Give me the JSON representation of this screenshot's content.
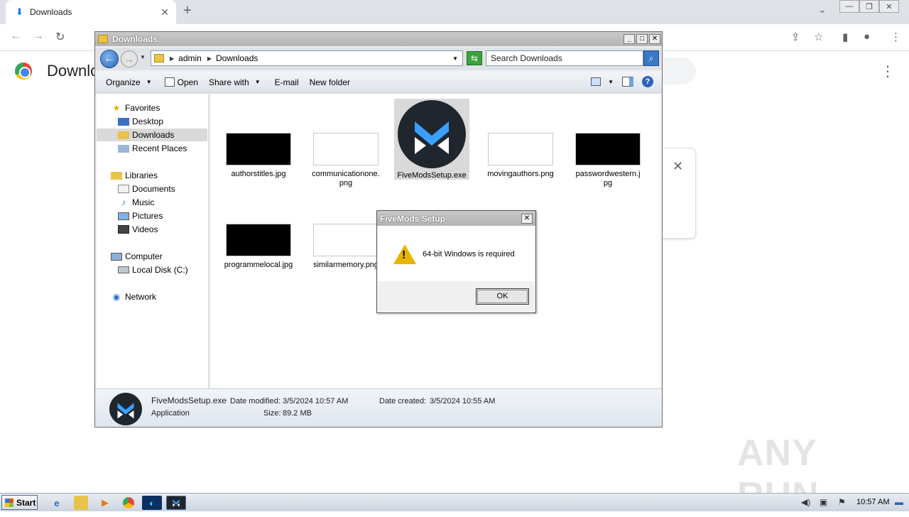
{
  "browser": {
    "tab_title": "Downloads",
    "page_title": "Downloads"
  },
  "explorer": {
    "title": "Downloads",
    "breadcrumb": [
      "admin",
      "Downloads"
    ],
    "search_placeholder": "Search Downloads",
    "commands": {
      "organize": "Organize",
      "open": "Open",
      "share_with": "Share with",
      "email": "E-mail",
      "new_folder": "New folder"
    },
    "nav": {
      "favorites": "Favorites",
      "desktop": "Desktop",
      "downloads": "Downloads",
      "recent_places": "Recent Places",
      "libraries": "Libraries",
      "documents": "Documents",
      "music": "Music",
      "pictures": "Pictures",
      "videos": "Videos",
      "computer": "Computer",
      "local_disk": "Local Disk (C:)",
      "network": "Network"
    },
    "files": [
      {
        "name": "authorstitles.jpg",
        "thumb": "dark"
      },
      {
        "name": "communicationone.png",
        "thumb": "light"
      },
      {
        "name": "FiveModsSetup.exe",
        "thumb": "logo",
        "selected": true
      },
      {
        "name": "movingauthors.png",
        "thumb": "light"
      },
      {
        "name": "passwordwestern.jpg",
        "thumb": "dark"
      },
      {
        "name": "programmelocal.jpg",
        "thumb": "dark"
      },
      {
        "name": "similarmemory.png",
        "thumb": "light"
      }
    ],
    "status": {
      "name": "FiveModsSetup.exe",
      "type": "Application",
      "date_modified_label": "Date modified:",
      "date_modified": "3/5/2024 10:57 AM",
      "size_label": "Size:",
      "size": "89.2 MB",
      "date_created_label": "Date created:",
      "date_created": "3/5/2024 10:55 AM"
    }
  },
  "dialog": {
    "title": "FiveMods Setup",
    "message": "64-bit Windows is required",
    "ok_label": "OK"
  },
  "taskbar": {
    "start_label": "Start",
    "clock": "10:57 AM"
  },
  "watermark": "ANY RUN",
  "colors": {
    "accent": "#2c65b5",
    "warning": "#e8b400",
    "fivemods_blue": "#3aa0ff"
  }
}
